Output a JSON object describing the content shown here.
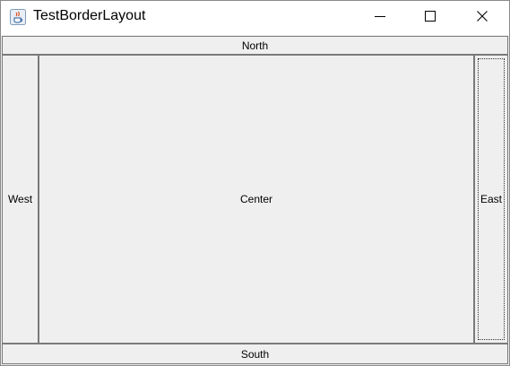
{
  "window": {
    "title": "TestBorderLayout",
    "icon": "java-coffee-cup-icon",
    "controls": [
      "minimize-icon",
      "maximize-icon",
      "close-icon"
    ]
  },
  "buttons": {
    "north": "North",
    "west": "West",
    "center": "Center",
    "east": "East",
    "south": "South"
  },
  "colors": {
    "panel_background": "#f0f0f0",
    "button_border": "#7a7a7a",
    "title_bar": "#ffffff"
  }
}
